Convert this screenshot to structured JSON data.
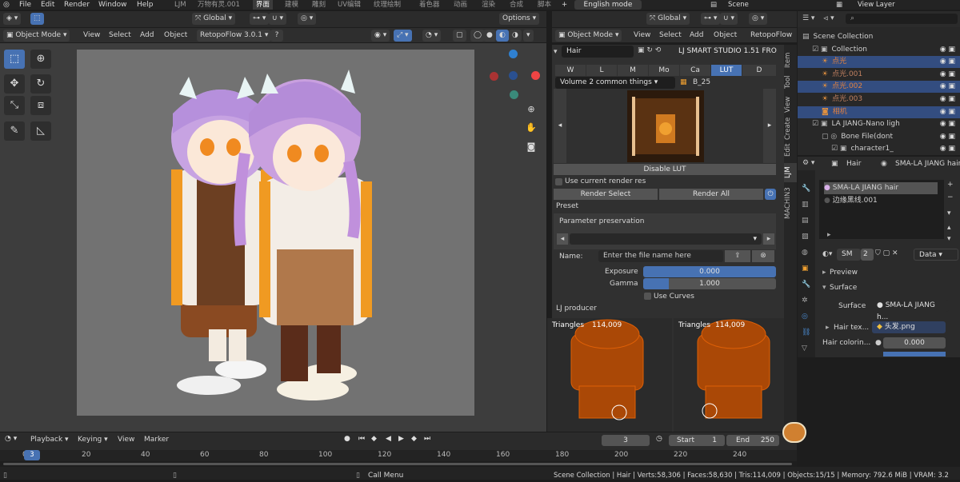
{
  "topbar": {
    "menus": [
      "File",
      "Edit",
      "Render",
      "Window",
      "Help"
    ],
    "workspaces": [
      "LJM",
      "万物有灵.001",
      "界面",
      "建模",
      "雕刻",
      "UV编辑",
      "纹理绘制",
      "着色器",
      "动画",
      "渲染",
      "合成",
      "脚本"
    ],
    "active_workspace": "界面",
    "mode_label": "English mode",
    "scene": "Scene",
    "view_layer": "View Layer"
  },
  "viewport": {
    "header": {
      "transform": "Global",
      "options": "Options"
    },
    "mode": "Object Mode",
    "menus": [
      "View",
      "Select",
      "Add",
      "Object"
    ],
    "addon": "RetopoFlow 3.0.1"
  },
  "right_editor": {
    "header": {
      "transform": "Global",
      "mode": "Object Mode",
      "menus": [
        "View",
        "Select",
        "Add",
        "Object"
      ],
      "addon": "RetopoFlow"
    },
    "npanel": {
      "object_name": "Hair",
      "studio_title": "LJ SMART STUDIO 1.51 FRO",
      "tabs": [
        "W",
        "L",
        "M",
        "Mo",
        "Ca",
        "LUT",
        "D"
      ],
      "active_tab": "LUT",
      "lut_set": "Volume 2 common things",
      "lut_name": "B_25",
      "disable_lut": "Disable LUT",
      "use_current_res": "Use current render res",
      "render_select": "Render Select",
      "render_all": "Render All",
      "preset": "Preset",
      "param_preservation": "Parameter preservation",
      "name_label": "Name:",
      "name_placeholder": "Enter the file name here",
      "exposure_label": "Exposure",
      "exposure_value": "0.000",
      "gamma_label": "Gamma",
      "gamma_value": "1.000",
      "use_curves": "Use Curves",
      "producer": "LJ producer"
    },
    "thumbs": [
      {
        "label": "Triangles",
        "value": "114,009"
      },
      {
        "label": "Triangles",
        "value": "114,009"
      }
    ],
    "side_tabs": [
      "Item",
      "Tool",
      "View",
      "Create",
      "Edit",
      "LJM",
      "MACHIN3"
    ]
  },
  "outliner": {
    "rows": [
      {
        "label": "Scene Collection",
        "indent": 0,
        "sel": false
      },
      {
        "label": "Collection",
        "indent": 1,
        "sel": false
      },
      {
        "label": "点光",
        "indent": 2,
        "sel": true
      },
      {
        "label": "点光.001",
        "indent": 2,
        "sel": false
      },
      {
        "label": "点光.002",
        "indent": 2,
        "sel": true
      },
      {
        "label": "点光.003",
        "indent": 2,
        "sel": false
      },
      {
        "label": "相机",
        "indent": 2,
        "sel": true
      },
      {
        "label": "LA JIANG-Nano ligh",
        "indent": 1,
        "sel": false
      },
      {
        "label": "Bone File(dont",
        "indent": 2,
        "sel": false
      },
      {
        "label": "character1_",
        "indent": 3,
        "sel": false
      }
    ]
  },
  "properties": {
    "object": "Hair",
    "material": "SMA-LA JIANG hair",
    "slots": [
      "SMA-LA JIANG hair",
      "边缘黑线.001"
    ],
    "slot_count": "SM",
    "users": "2",
    "data": "Data",
    "preview": "Preview",
    "surface_header": "Surface",
    "surface_label": "Surface",
    "surface_value": "SMA-LA JIANG h...",
    "hair_tex_label": "Hair tex...",
    "hair_tex_value": "头发.png",
    "hair_color_label": "Hair colorin...",
    "hair_color_value": "0.000"
  },
  "timeline": {
    "playback": "Playback",
    "keying": "Keying",
    "view": "View",
    "marker": "Marker",
    "current_frame": "3",
    "start_label": "Start",
    "start": "1",
    "end_label": "End",
    "end": "250",
    "ticks": [
      "0",
      "20",
      "40",
      "60",
      "80",
      "100",
      "120",
      "140",
      "160",
      "180",
      "200",
      "220",
      "240"
    ],
    "cursor": "3"
  },
  "status": {
    "call_menu": "Call Menu",
    "stats": "Scene Collection | Hair | Verts:58,306 | Faces:58,630 | Tris:114,009 | Objects:15/15 | Memory: 792.6 MiB | VRAM: 3.2"
  },
  "colors": {
    "accent": "#4772b3",
    "selected_row": "#334d80",
    "wire": "#ff6a00"
  }
}
